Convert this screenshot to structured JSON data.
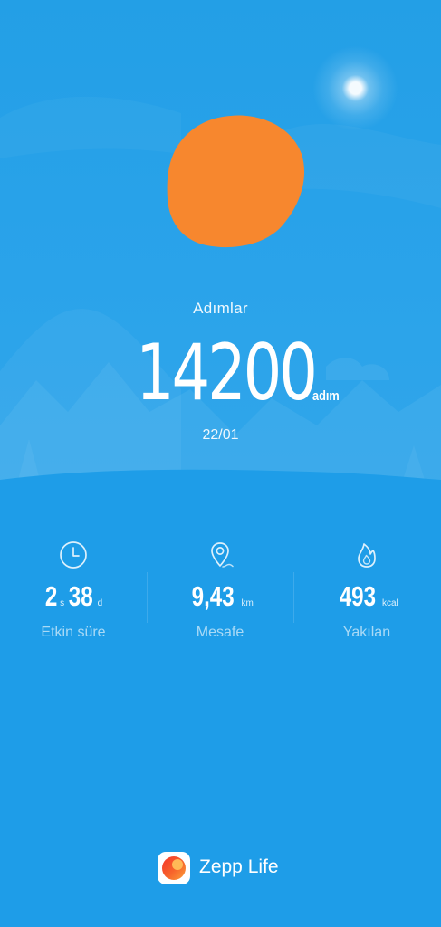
{
  "summary": {
    "label": "Adımlar",
    "steps": "14200",
    "unit": "adım",
    "date": "22/01"
  },
  "stats": [
    {
      "icon": "clock-icon",
      "hours": "2",
      "hours_unit": "s",
      "minutes": "38",
      "minutes_unit": "d",
      "label": "Etkin süre"
    },
    {
      "icon": "location-pin-icon",
      "value": "9,43",
      "unit": "km",
      "label": "Mesafe"
    },
    {
      "icon": "flame-icon",
      "value": "493",
      "unit": "kcal",
      "label": "Yakılan"
    }
  ],
  "brand": {
    "name": "Zepp Life"
  },
  "colors": {
    "background": "#1e9de8",
    "redaction": "#f7872e",
    "text": "#ffffff"
  }
}
